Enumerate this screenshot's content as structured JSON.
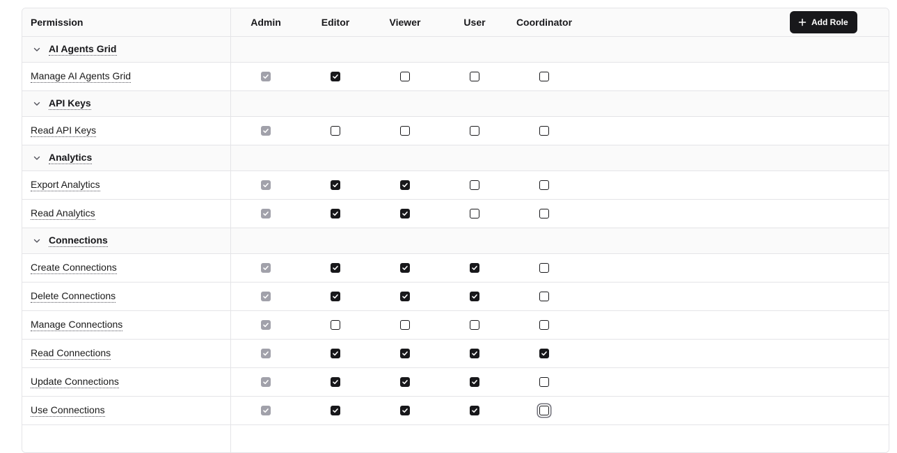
{
  "header": {
    "permission_label": "Permission",
    "roles": [
      "Admin",
      "Editor",
      "Viewer",
      "User",
      "Coordinator"
    ],
    "add_role_label": "Add Role"
  },
  "rows": [
    {
      "type": "group",
      "label": "AI Agents Grid"
    },
    {
      "type": "perm",
      "label": "Manage AI Agents Grid",
      "states": [
        "disabled",
        "checked",
        "unchecked",
        "unchecked",
        "unchecked"
      ]
    },
    {
      "type": "group",
      "label": "API Keys"
    },
    {
      "type": "perm",
      "label": "Read API Keys",
      "states": [
        "disabled",
        "unchecked",
        "unchecked",
        "unchecked",
        "unchecked"
      ]
    },
    {
      "type": "group",
      "label": "Analytics"
    },
    {
      "type": "perm",
      "label": "Export Analytics",
      "states": [
        "disabled",
        "checked",
        "checked",
        "unchecked",
        "unchecked"
      ]
    },
    {
      "type": "perm",
      "label": "Read Analytics",
      "states": [
        "disabled",
        "checked",
        "checked",
        "unchecked",
        "unchecked"
      ]
    },
    {
      "type": "group",
      "label": "Connections"
    },
    {
      "type": "perm",
      "label": "Create Connections",
      "states": [
        "disabled",
        "checked",
        "checked",
        "checked",
        "unchecked"
      ]
    },
    {
      "type": "perm",
      "label": "Delete Connections",
      "states": [
        "disabled",
        "checked",
        "checked",
        "checked",
        "unchecked"
      ]
    },
    {
      "type": "perm",
      "label": "Manage Connections",
      "states": [
        "disabled",
        "unchecked",
        "unchecked",
        "unchecked",
        "unchecked"
      ]
    },
    {
      "type": "perm",
      "label": "Read Connections",
      "states": [
        "disabled",
        "checked",
        "checked",
        "checked",
        "checked"
      ]
    },
    {
      "type": "perm",
      "label": "Update Connections",
      "states": [
        "disabled",
        "checked",
        "checked",
        "checked",
        "unchecked"
      ]
    },
    {
      "type": "perm",
      "label": "Use Connections",
      "states": [
        "disabled",
        "checked",
        "checked",
        "checked",
        "focused"
      ]
    },
    {
      "type": "perm",
      "label": "",
      "states": []
    }
  ],
  "colors": {
    "checked": "#18181b",
    "disabled": "#a1a1aa",
    "border": "#e4e4e7",
    "header_bg": "#fafafa"
  }
}
